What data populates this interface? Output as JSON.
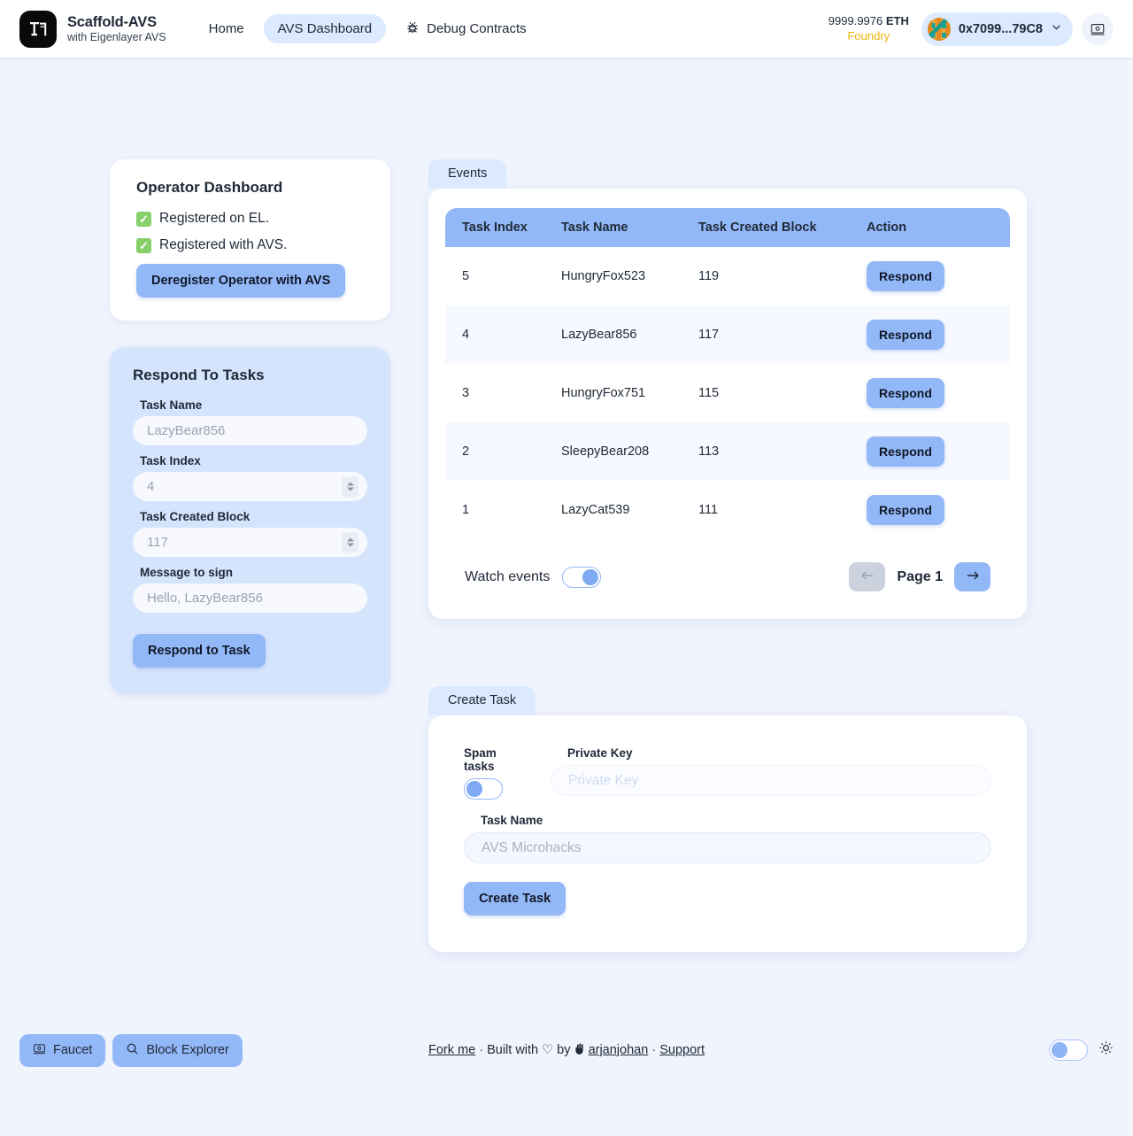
{
  "header": {
    "brand_title": "Scaffold-AVS",
    "brand_subtitle": "with Eigenlayer AVS",
    "nav": [
      {
        "label": "Home",
        "active": false
      },
      {
        "label": "AVS Dashboard",
        "active": true
      },
      {
        "label": "Debug Contracts",
        "active": false,
        "icon": "bug-icon"
      }
    ],
    "balance_amount": "9999.9976",
    "balance_unit": "ETH",
    "network": "Foundry",
    "wallet_address": "0x7099...79C8",
    "wallet_chevron": "chevron-down-icon",
    "right_icon": "block-explorer-icon"
  },
  "operator_dashboard": {
    "title": "Operator Dashboard",
    "statuses": [
      {
        "check": "✓",
        "label": "Registered on EL."
      },
      {
        "check": "✓",
        "label": "Registered with AVS."
      }
    ],
    "deregister_button": "Deregister Operator with AVS"
  },
  "respond_to_tasks": {
    "title": "Respond To Tasks",
    "fields": [
      {
        "label": "Task Name",
        "placeholder": "LazyBear856",
        "type": "text"
      },
      {
        "label": "Task Index",
        "placeholder": "4",
        "type": "number"
      },
      {
        "label": "Task Created Block",
        "placeholder": "117",
        "type": "number"
      },
      {
        "label": "Message to sign",
        "placeholder": "Hello, LazyBear856",
        "type": "text"
      }
    ],
    "submit_button": "Respond to Task"
  },
  "events": {
    "tab_label": "Events",
    "columns": [
      "Task Index",
      "Task Name",
      "Task Created Block",
      "Action"
    ],
    "rows": [
      {
        "task_index": "5",
        "task_name": "HungryFox523",
        "task_created_block": "119",
        "action": "Respond"
      },
      {
        "task_index": "4",
        "task_name": "LazyBear856",
        "task_created_block": "117",
        "action": "Respond"
      },
      {
        "task_index": "3",
        "task_name": "HungryFox751",
        "task_created_block": "115",
        "action": "Respond"
      },
      {
        "task_index": "2",
        "task_name": "SleepyBear208",
        "task_created_block": "113",
        "action": "Respond"
      },
      {
        "task_index": "1",
        "task_name": "LazyCat539",
        "task_created_block": "111",
        "action": "Respond"
      }
    ],
    "watch_label": "Watch events",
    "watch_enabled": true,
    "page_label": "Page 1",
    "prev_icon": "arrow-left-icon",
    "next_icon": "arrow-right-icon",
    "prev_disabled": true
  },
  "create_task": {
    "tab_label": "Create Task",
    "spam_label": "Spam tasks",
    "spam_enabled": false,
    "private_key_label": "Private Key",
    "private_key_placeholder": "Private Key",
    "task_name_label": "Task Name",
    "task_name_placeholder": "AVS Microhacks",
    "submit_button": "Create Task"
  },
  "footer": {
    "faucet_button": "Faucet",
    "faucet_icon": "faucet-icon",
    "block_explorer_button": "Block Explorer",
    "block_explorer_icon": "search-icon",
    "fork_me": "Fork me",
    "built_with": "Built with",
    "heart": "♡",
    "by": "by",
    "author": "arjanjohan",
    "support": "Support",
    "separator": "·",
    "theme_enabled": false,
    "theme_icon": "sun-icon"
  },
  "colors": {
    "accent": "#93b8f7",
    "page_bg": "#f0f4fd",
    "tab_bg": "#dbeafe",
    "panel_blue": "#d5e4fd",
    "check_green": "#86d06a",
    "network_yellow": "#eab308"
  }
}
